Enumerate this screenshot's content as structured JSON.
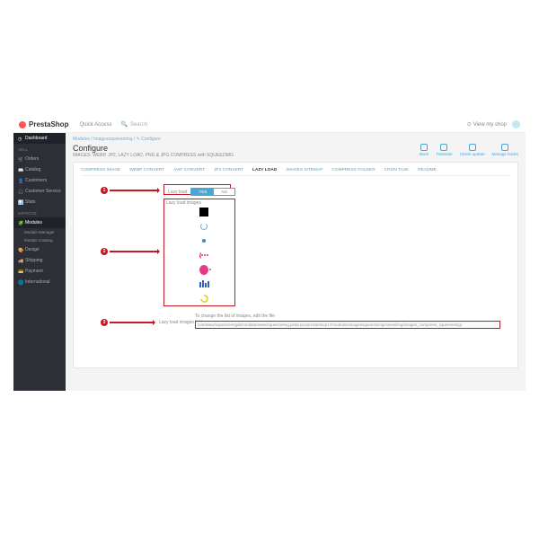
{
  "brand": "PrestaShop",
  "quick_access": "Quick Access",
  "search_placeholder": "Search",
  "view_shop": "View my shop",
  "sidebar": {
    "dashboard": "Dashboard",
    "sections": {
      "sell": "SELL",
      "improve": "IMPROVE"
    },
    "items": {
      "orders": "Orders",
      "catalog": "Catalog",
      "customers": "Customers",
      "customer_service": "Customer Service",
      "stats": "Stats",
      "modules": "Modules",
      "module_manager": "Module Manager",
      "module_catalog": "Module Catalog",
      "design": "Design",
      "shipping": "Shipping",
      "payment": "Payment",
      "international": "International"
    }
  },
  "breadcrumb": "Modules / Imagessqueezeimg / ✎ Configure",
  "page": {
    "title": "Configure",
    "subtitle": "IMAGES: WEBP, JP2, LAZY LOAD, PNG & JPG COMPRESS with SQUEEZIMG"
  },
  "actions": {
    "back": "Back",
    "translate": "Translate",
    "check_update": "Check update",
    "manage_hooks": "Manage hooks"
  },
  "tabs": {
    "compress": "COMPRESS IMAGE",
    "webp": "WEBP CONVERT",
    "avif": "AVIF CONVERT",
    "jp2": "JP2 CONVERT",
    "lazy": "LAZY LOAD",
    "sitemap": "IMAGES SITEMAP",
    "folder": "COMPRESS FOLDER",
    "crontask": "CRON TASK",
    "readme": "README"
  },
  "form": {
    "lazy_label": "Lazy load",
    "yes": "YES",
    "no": "NO",
    "images_label": "Lazy load images",
    "folder_label": "Lazy load images folder",
    "folder_hint": "To change the list of images, edit the file",
    "folder_path": "/var/www/squeezeimgdemo/data/www/squeezeimg.pinta.pro/prestashop17/modules/imagessqueezeimg/views/img/images_compress_squeezeimg/"
  },
  "callouts": {
    "c1": "1",
    "c2": "2",
    "c3": "3"
  }
}
